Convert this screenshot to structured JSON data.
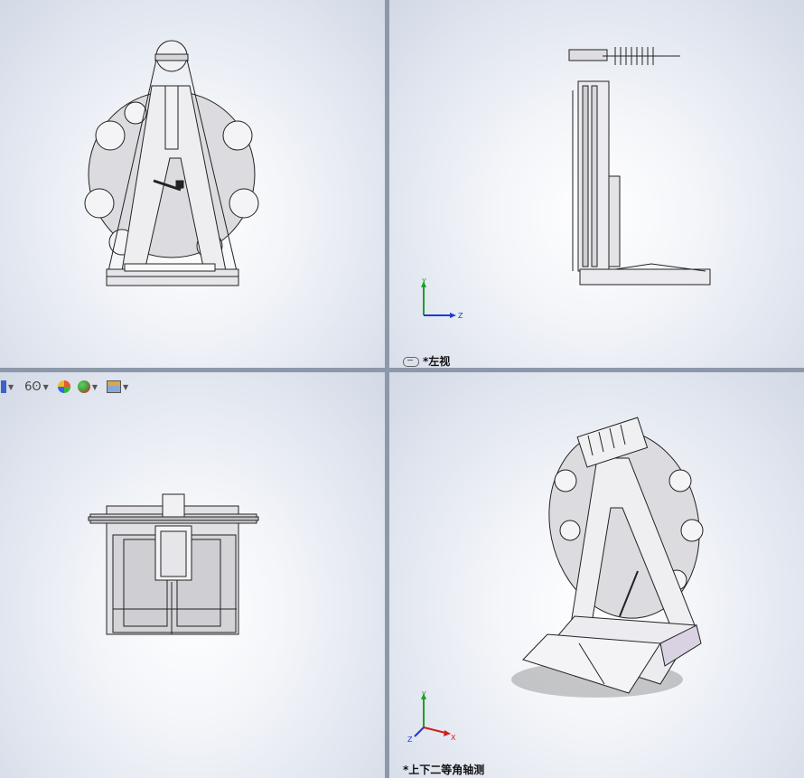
{
  "viewports": {
    "top_left": {
      "label": ""
    },
    "top_right": {
      "label": "*左视"
    },
    "bottom_left": {
      "label": ""
    },
    "bottom_right": {
      "label": "*上下二等角轴测"
    }
  },
  "toolbar": {
    "icons": [
      "display-style-icon",
      "hide-show-icon",
      "appearance-icon",
      "scene-icon",
      "view-settings-icon"
    ]
  },
  "axis_labels": {
    "x": "X",
    "y": "Y",
    "z": "Z"
  },
  "colors": {
    "x_axis": "#d11e1e",
    "y_axis": "#1f9e2a",
    "z_axis": "#1e3ad1",
    "edge": "#222222",
    "face": "#e6e6ea"
  }
}
